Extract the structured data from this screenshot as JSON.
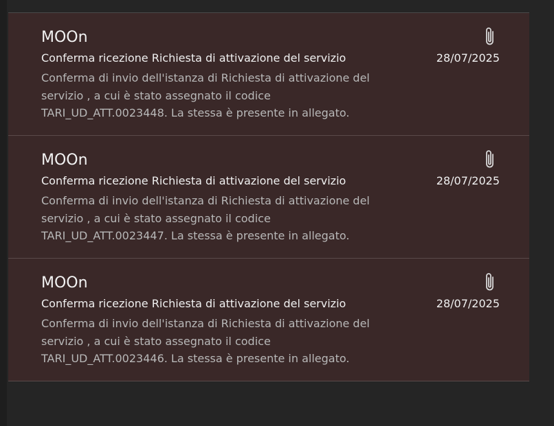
{
  "messages": [
    {
      "sender": "MOOn",
      "subject": "Conferma ricezione Richiesta di attivazione del servizio",
      "preview": "Conferma di invio dell'istanza di Richiesta di attivazione del\nservizio , a cui è stato assegnato il codice\nTARI_UD_ATT.0023448.  La stessa è presente in allegato.",
      "date": "28/07/2025",
      "icon": "paperclip-icon"
    },
    {
      "sender": "MOOn",
      "subject": "Conferma ricezione Richiesta di attivazione del servizio",
      "preview": "Conferma di invio dell'istanza di Richiesta di attivazione del\nservizio , a cui è stato assegnato il codice\nTARI_UD_ATT.0023447.  La stessa è presente in allegato.",
      "date": "28/07/2025",
      "icon": "paperclip-icon"
    },
    {
      "sender": "MOOn",
      "subject": "Conferma ricezione Richiesta di attivazione del servizio",
      "preview": "Conferma di invio dell'istanza di Richiesta di attivazione del\nservizio , a cui è stato assegnato il codice\nTARI_UD_ATT.0023446.  La stessa è presente in allegato.",
      "date": "28/07/2025",
      "icon": "paperclip-icon"
    }
  ],
  "colors": {
    "page_bg": "#252525",
    "item_bg": "#3a2828",
    "text_primary": "#f0f0f0",
    "text_secondary": "#b8b8b8"
  }
}
